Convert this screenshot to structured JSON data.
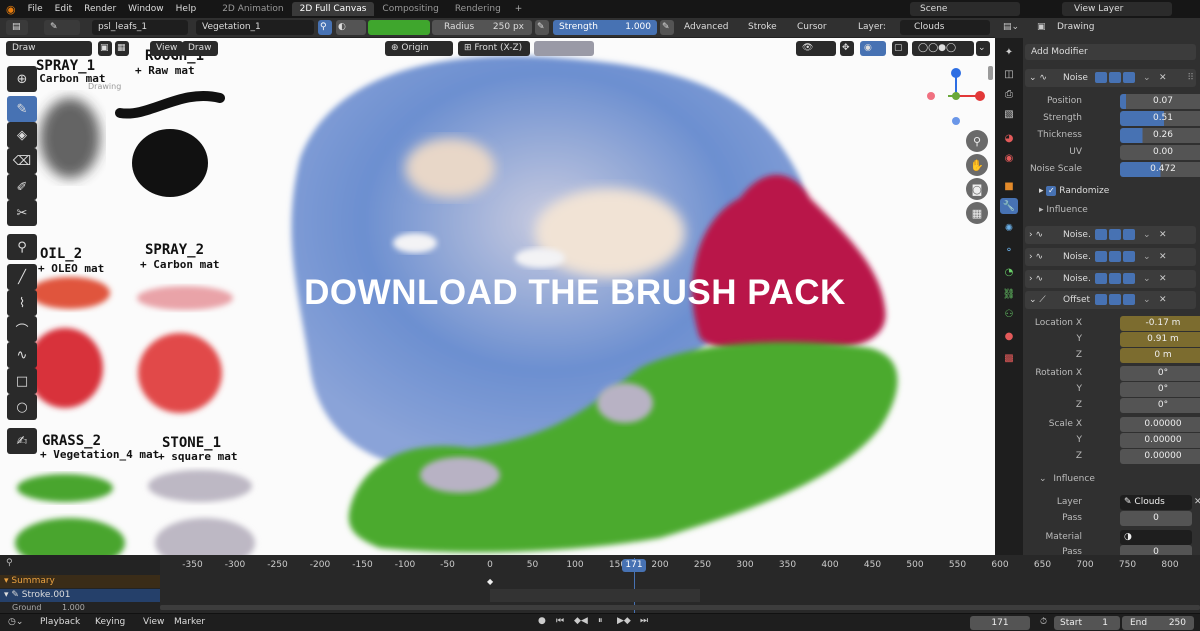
{
  "menu": {
    "items": [
      "File",
      "Edit",
      "Render",
      "Window",
      "Help"
    ]
  },
  "workspace_tabs": [
    {
      "label": "2D Animation",
      "active": false
    },
    {
      "label": "2D Full Canvas",
      "active": true
    },
    {
      "label": "Compositing",
      "active": false
    },
    {
      "label": "Rendering",
      "active": false
    }
  ],
  "scene": {
    "name": "Scene",
    "view_layer": "View Layer"
  },
  "toolbar": {
    "brush_name": "psl_leafs_1",
    "material": "Vegetation_1",
    "radius_label": "Radius",
    "radius_value": "250 px",
    "strength_label": "Strength",
    "strength_value": "1.000",
    "advanced": "Advanced",
    "stroke": "Stroke",
    "cursor": "Cursor",
    "layer_label": "Layer:",
    "layer_value": "Clouds",
    "color": "#3fa62d"
  },
  "viewport": {
    "mode": "Draw",
    "view_menu": "View",
    "draw_menu": "Draw",
    "origin": "Origin",
    "front": "Front (X-Z)",
    "overlay_title": "DOWNLOAD THE BRUSH PACK",
    "corner_text": "Drawing",
    "samples": [
      {
        "name": "SPRAY_1",
        "sub": "+ Carbon mat"
      },
      {
        "name": "ROUGH_1",
        "sub": "+ Raw mat"
      },
      {
        "name": "OIL_2",
        "sub": "+ OLEO mat"
      },
      {
        "name": "SPRAY_2",
        "sub": "+ Carbon mat"
      },
      {
        "name": "GRASS_2",
        "sub": "+ Vegetation_4 mat"
      },
      {
        "name": "STONE_1",
        "sub": "+ square mat"
      }
    ]
  },
  "properties": {
    "object": "Drawing",
    "add_modifier": "Add Modifier",
    "noise": {
      "name": "Noise",
      "position": {
        "label": "Position",
        "value": "0.07",
        "fraction": 0.07
      },
      "strength": {
        "label": "Strength",
        "value": "0.51",
        "fraction": 0.51
      },
      "thickness": {
        "label": "Thickness",
        "value": "0.26",
        "fraction": 0.26
      },
      "uv": {
        "label": "UV",
        "value": "0.00",
        "fraction": 0.0
      },
      "noise_scale": {
        "label": "Noise Scale",
        "value": "0.472",
        "fraction": 0.472
      },
      "randomize": "Randomize",
      "influence": "Influence"
    },
    "more_modifiers": [
      "Noise.",
      "Noise.",
      "Noise."
    ],
    "offset": {
      "name": "Offset",
      "location_x": {
        "label": "Location X",
        "value": "-0.17 m"
      },
      "location_y": {
        "label": "Y",
        "value": "0.91 m"
      },
      "location_z": {
        "label": "Z",
        "value": "0 m"
      },
      "rotation_x": {
        "label": "Rotation X",
        "value": "0°"
      },
      "rotation_y": {
        "label": "Y",
        "value": "0°"
      },
      "rotation_z": {
        "label": "Z",
        "value": "0°"
      },
      "scale_x": {
        "label": "Scale X",
        "value": "0.00000"
      },
      "scale_y": {
        "label": "Y",
        "value": "0.00000"
      },
      "scale_z": {
        "label": "Z",
        "value": "0.00000"
      },
      "influence": "Influence",
      "layer_label": "Layer",
      "layer_value": "Clouds",
      "pass_label": "Pass",
      "pass_value": "0",
      "material_label": "Material",
      "pass2_label": "Pass",
      "pass2_value": "0"
    }
  },
  "timeline": {
    "summary": "Summary",
    "stroke": "Stroke.001",
    "ground": "Ground",
    "ground_value": "1.000",
    "current_frame": "171",
    "ticks": [
      "-350",
      "-300",
      "-250",
      "-200",
      "-150",
      "-100",
      "-50",
      "0",
      "50",
      "100",
      "150",
      "171",
      "200",
      "250",
      "300",
      "350",
      "400",
      "450",
      "500",
      "550",
      "600",
      "650",
      "700",
      "750",
      "800"
    ]
  },
  "footer": {
    "playback": "Playback",
    "keying": "Keying",
    "view": "View",
    "marker": "Marker",
    "frame": "171",
    "start_label": "Start",
    "start_value": "1",
    "end_label": "End",
    "end_value": "250"
  }
}
